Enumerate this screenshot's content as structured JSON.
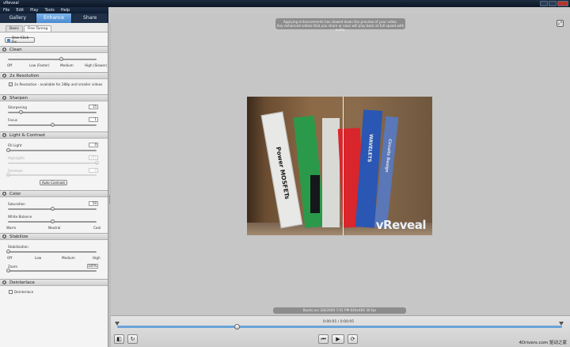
{
  "window": {
    "title": "vReveal",
    "overlay_text": "4Drivers.com 驱动之家"
  },
  "menu": [
    "File",
    "Edit",
    "Play",
    "Tools",
    "Help"
  ],
  "main_tabs": [
    {
      "label": "Gallery",
      "active": false
    },
    {
      "label": "Enhance",
      "active": true
    },
    {
      "label": "Share",
      "active": false
    }
  ],
  "sub_tabs": [
    {
      "label": "Basic",
      "active": false
    },
    {
      "label": "Fine Tuning",
      "active": true
    }
  ],
  "one_click_fix": "One-Click Fix",
  "clean": {
    "title": "Clean",
    "ticks": [
      "Off",
      "Low (Faster)",
      "Medium",
      "High (Slower)"
    ],
    "level_fraction": 0.6
  },
  "resolution": {
    "title": "2x Resolution",
    "checkbox_label": "2x Resolution - available for 288p and smaller videos",
    "checked": true
  },
  "sharpen": {
    "title": "Sharpen",
    "sharpening": {
      "label": "Sharpening",
      "value": "15",
      "fraction": 0.15
    },
    "focus": {
      "label": "Focus",
      "value": "1",
      "fraction": 0.5
    }
  },
  "light": {
    "title": "Light & Contrast",
    "fill_light": {
      "label": "Fill Light",
      "value": "0",
      "fraction": 0.0
    },
    "highlights": {
      "label": "Highlights",
      "value": "255",
      "fraction": 1.0
    },
    "shadows": {
      "label": "Shadows",
      "value": "0",
      "fraction": 0.0
    },
    "auto_button": "Auto Contrast"
  },
  "color": {
    "title": "Color",
    "saturation": {
      "label": "Saturation",
      "value": "50",
      "fraction": 0.5
    },
    "white_balance": {
      "label": "White Balance",
      "fraction": 0.5
    },
    "wb_ticks": [
      "Warm",
      "Neutral",
      "Cool"
    ]
  },
  "stabilize": {
    "title": "Stabilize",
    "stabilization": {
      "label": "Stabilization",
      "fraction": 0.0
    },
    "ticks": [
      "Off",
      "Low",
      "Medium",
      "High"
    ],
    "zoom": {
      "label": "Zoom",
      "value": "100%",
      "fraction": 0.0
    }
  },
  "deinterlace": {
    "title": "Deinterlace",
    "checkbox_label": "Deinterlace",
    "checked": false
  },
  "viewer": {
    "banner_line1": "Applying enhancements has slowed down the preview of your video.",
    "banner_line2": "Any enhanced videos that you share or save will play back at full speed with audio.",
    "watermark": "vReveal",
    "book_titles": [
      "Power MOSFETs",
      "WAVELETS",
      "Circuits Design"
    ],
    "info": "Books.avi    3/8/2009 7:01 PM    640x480    30 fps",
    "timecode": "0:00:01 / 0:00:05",
    "progress_fraction": 0.27
  },
  "colors": {
    "accent": "#4a88cc",
    "timeline": "#6aa4da",
    "titlebar": "#13213a"
  },
  "icons": [
    "fullscreen-icon",
    "split-view-icon",
    "rotate-icon",
    "prev-frame-icon",
    "play-icon",
    "loop-icon"
  ]
}
